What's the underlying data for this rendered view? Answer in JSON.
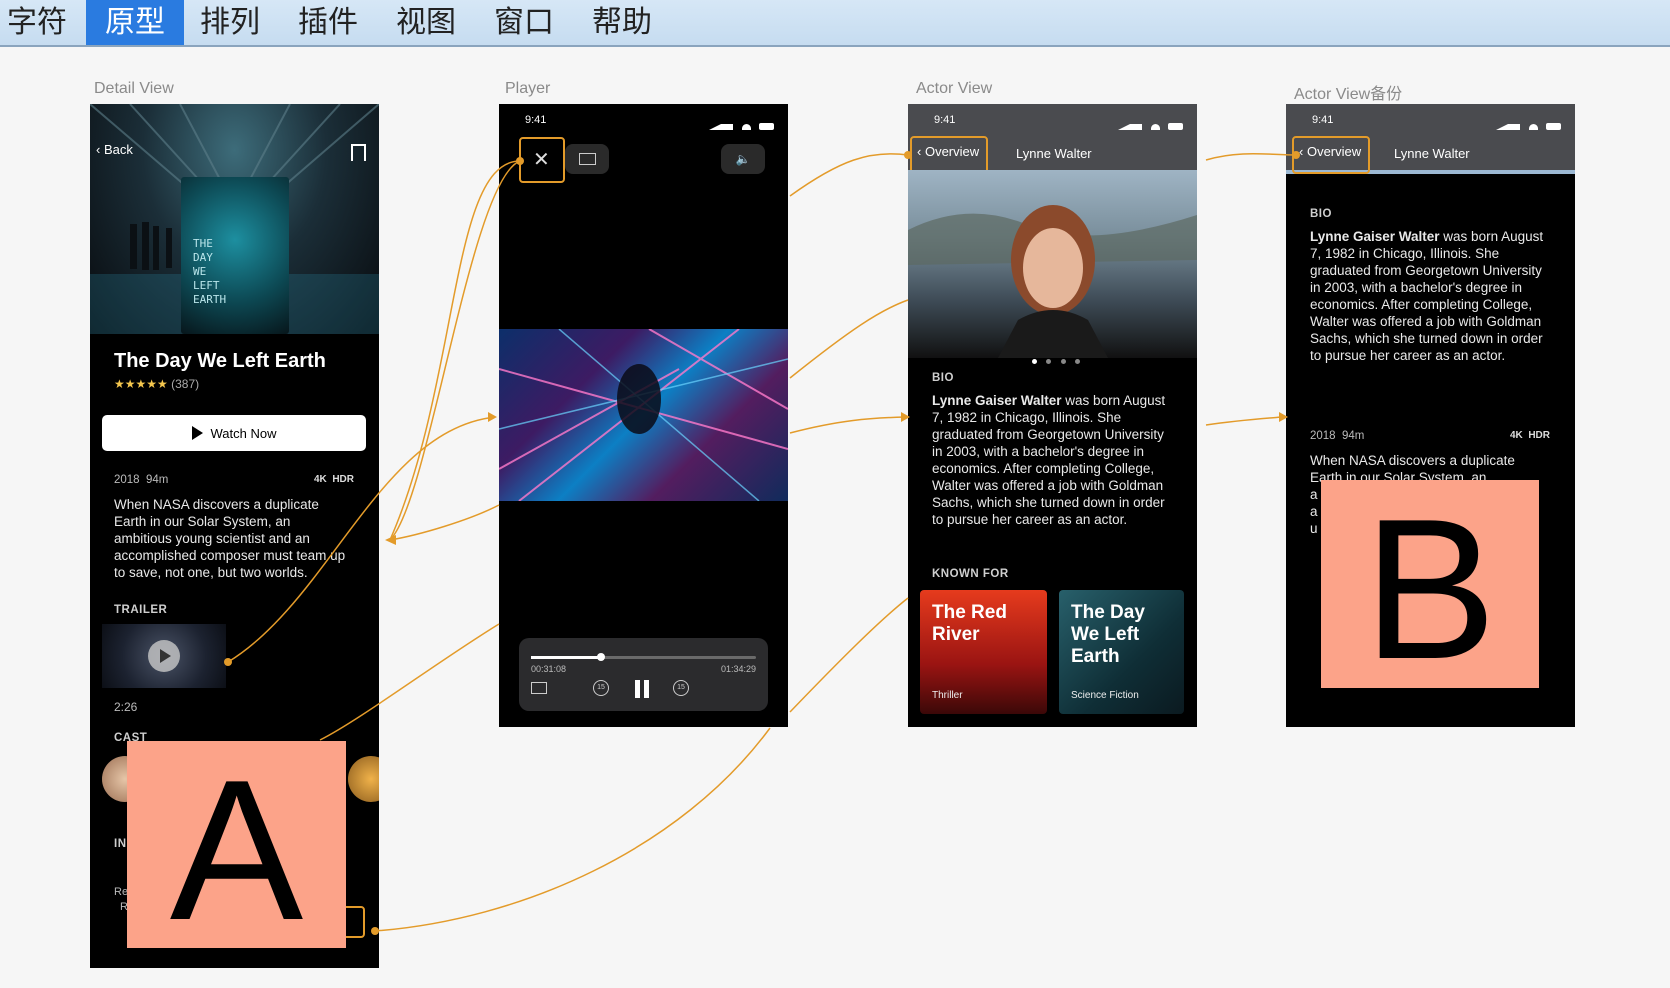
{
  "menu": [
    "字符",
    "原型",
    "排列",
    "插件",
    "视图",
    "窗口",
    "帮助"
  ],
  "active_menu": "原型",
  "frames": {
    "detail": {
      "label": "Detail View",
      "back": "Back",
      "poster_text": "THE\nDAY\nWE\nLEFT\nEARTH",
      "title": "The Day We Left Earth",
      "stars": "★★★★★",
      "rating_count": "(387)",
      "watch_now": "Watch Now",
      "year": "2018",
      "duration": "94m",
      "quality_4k": "4K",
      "quality_hdr": "HDR",
      "synopsis": "When NASA discovers a duplicate Earth in our Solar System, an ambitious young scientist and an accomplished composer must team up to save, not one, but two worlds.",
      "trailer_label": "TRAILER",
      "trailer_time": "2:26",
      "cast_label": "CAST",
      "in_label": "IN",
      "re_label": "Re",
      "r_label": "R",
      "e_label": "e"
    },
    "player": {
      "label": "Player",
      "time": "9:41",
      "elapsed": "00:31:08",
      "remaining": "01:34:29",
      "skip_back": "15",
      "skip_fwd": "15",
      "progress": 0.31
    },
    "actor": {
      "label": "Actor View",
      "time": "9:41",
      "overview": "Overview",
      "name": "Lynne Walter",
      "bio_label": "BIO",
      "bio_name": "Lynne Gaiser Walter",
      "bio_rest": " was born August 7, 1982 in Chicago, Illinois. She graduated from Georgetown University in 2003, with a bachelor's degree in economics. After completing College, Walter was offered a job with Goldman Sachs, which she turned down in order to pursue her career as an actor.",
      "known_for": "KNOWN FOR",
      "card1_title": "The Red River",
      "card1_genre": "Thriller",
      "card2_title": "The Day We Left Earth",
      "card2_genre": "Science Fiction"
    },
    "actor_copy": {
      "label": "Actor View备份",
      "time": "9:41",
      "overview": "Overview",
      "name": "Lynne Walter",
      "bio_label": "BIO",
      "bio_name": "Lynne Gaiser Walter",
      "bio_rest": " was born August 7, 1982 in Chicago, Illinois. She graduated from Georgetown University in 2003, with a bachelor's degree in economics. After completing College, Walter was offered a job with Goldman Sachs, which she turned down in order to pursue her career as an actor.",
      "year": "2018",
      "duration": "94m",
      "quality_4k": "4K",
      "quality_hdr": "HDR",
      "synopsis_visible": "When NASA discovers a duplicate",
      "synopsis_partial": "Earth in our Solar System, an",
      "line_a1": "a",
      "line_a2": "a",
      "line_u": "u"
    }
  },
  "overlays": {
    "a": "A",
    "b": "B"
  },
  "colors": {
    "accent": "#e39b2a",
    "overlay": "#fca389",
    "menu_active": "#2a7be0"
  }
}
